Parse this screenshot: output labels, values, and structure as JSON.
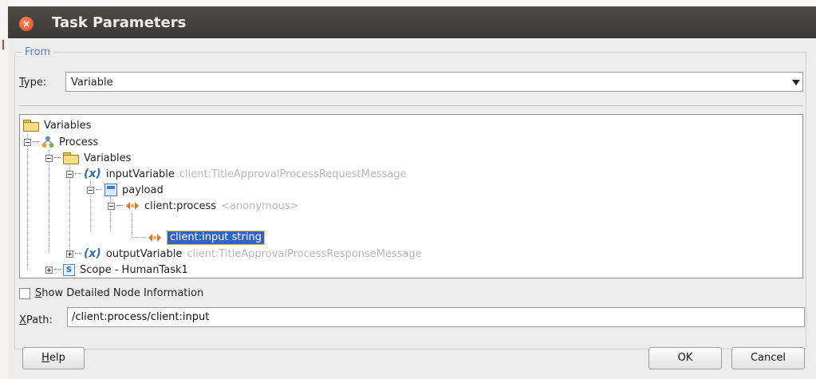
{
  "dialog": {
    "title": "Task Parameters",
    "close_glyph": "×"
  },
  "from_group": {
    "legend": "From",
    "type_label_mnemonic": "T",
    "type_label_rest": "ype:",
    "type_value": "Variable"
  },
  "tree": {
    "root_label": "Variables",
    "process_label": "Process",
    "variables_label": "Variables",
    "input_variable": {
      "label": "inputVariable",
      "type": "client:TitleApprovalProcessRequestMessage"
    },
    "payload_label": "payload",
    "client_process": {
      "label": "client:process",
      "type": "<anonymous>"
    },
    "client_input": {
      "label": "client:input string",
      "selected": true
    },
    "output_variable": {
      "label": "outputVariable",
      "type": "client:TitleApprovalProcessResponseMessage"
    },
    "scope_label": "Scope - HumanTask1",
    "icons": [
      "folder-icon",
      "process-icon",
      "variable-icon",
      "payload-icon",
      "element-icon",
      "scope-icon"
    ]
  },
  "options": {
    "show_detail_mnemonic": "S",
    "show_detail_rest": "how Detailed Node Information",
    "show_detail_checked": false
  },
  "xpath": {
    "label_mnemonic": "X",
    "label_rest": "Path:",
    "value": "/client:process/client:input"
  },
  "buttons": {
    "help_mnemonic": "H",
    "help_rest": "elp",
    "ok": "OK",
    "cancel": "Cancel"
  },
  "colors": {
    "titlebar": "#3b3a36",
    "selection": "#2f63c9",
    "legend_text": "#5a7fbf",
    "close_button": "#df4a1c"
  }
}
